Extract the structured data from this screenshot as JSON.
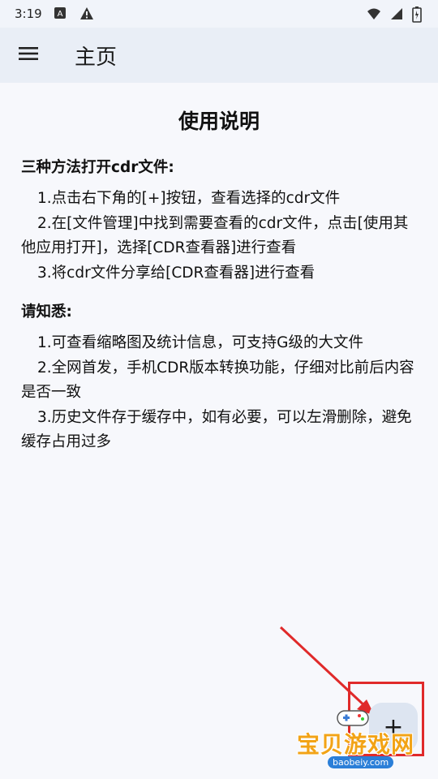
{
  "status_bar": {
    "time": "3:19",
    "icons": [
      "keyboard-a-icon",
      "warning-icon",
      "wifi-icon",
      "signal-icon",
      "battery-icon"
    ]
  },
  "app_bar": {
    "menu_icon": "hamburger-menu-icon",
    "title": "主页"
  },
  "content": {
    "title": "使用说明",
    "sections": [
      {
        "heading": "三种方法打开cdr文件:",
        "items": [
          "1.点击右下角的[+]按钮，查看选择的cdr文件",
          "2.在[文件管理]中找到需要查看的cdr文件，点击[使用其他应用打开]，选择[CDR查看器]进行查看",
          "3.将cdr文件分享给[CDR查看器]进行查看"
        ]
      },
      {
        "heading": "请知悉:",
        "items": [
          "1.可查看缩略图及统计信息，可支持G级的大文件",
          "2.全网首发，手机CDR版本转换功能，仔细对比前后内容是否一致",
          "3.历史文件存于缓存中，如有必要，可以左滑删除，避免缓存占用过多"
        ]
      }
    ]
  },
  "fab": {
    "icon": "plus-icon",
    "label": "+"
  },
  "watermark": {
    "text": "宝贝游戏网",
    "url": "baobeiy.com"
  },
  "colors": {
    "app_bar_bg": "#e9eef6",
    "page_bg": "#f7f8fc",
    "annotation_red": "#e02a2a",
    "watermark_orange": "#f2a316"
  }
}
